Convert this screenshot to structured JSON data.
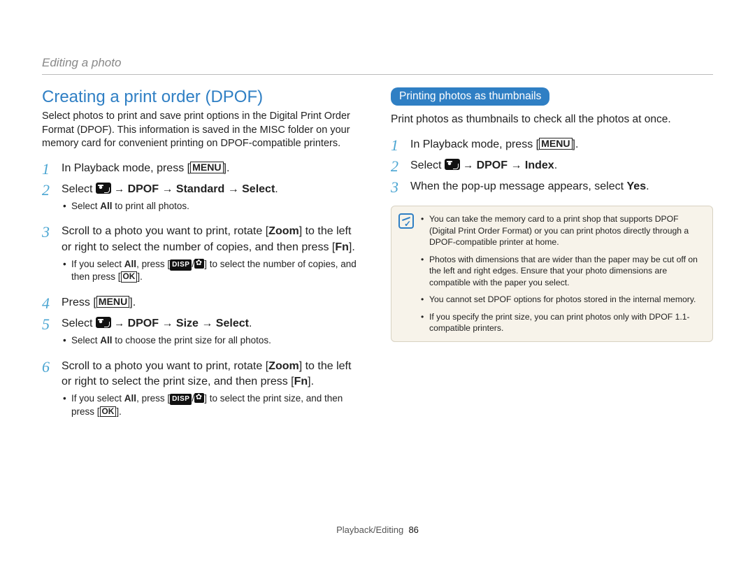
{
  "section_label": "Editing a photo",
  "left": {
    "heading": "Creating a print order (DPOF)",
    "intro": "Select photos to print and save print options in the Digital Print Order Format (DPOF). This information is saved in the MISC folder on your memory card for convenient printing on DPOF-compatible printers.",
    "steps": [
      {
        "num": "1",
        "prefix": "In Playback mode, press [",
        "key": "MENU",
        "suffix": "]."
      },
      {
        "num": "2",
        "select_prefix": "Select ",
        "after_icon": " → ",
        "bold_parts": "DPOF → Standard → Select",
        "tail": ".",
        "sub": [
          {
            "pre": "Select ",
            "bold": "All",
            "post": " to print all photos."
          }
        ]
      },
      {
        "num": "3",
        "text_before_zoom": "Scroll to a photo you want to print, rotate [",
        "zoom": "Zoom",
        "text_mid": "] to the left or right to select the number of copies, and then press [",
        "fn": "Fn",
        "text_after": "].",
        "sub": [
          {
            "pre": "If you select ",
            "bold": "All",
            "mid1": ", press [",
            "disp": "DISP",
            "slash": "/",
            "mid2": "] to select the number of copies, and then press [",
            "ok": "OK",
            "post": "]."
          }
        ]
      },
      {
        "num": "4",
        "prefix": "Press [",
        "key": "MENU",
        "suffix": "]."
      },
      {
        "num": "5",
        "select_prefix": "Select ",
        "after_icon": " → ",
        "bold_parts": "DPOF → Size → Select",
        "tail": ".",
        "sub": [
          {
            "pre": "Select ",
            "bold": "All",
            "post": " to choose the print size for all photos."
          }
        ]
      },
      {
        "num": "6",
        "text_before_zoom": "Scroll to a photo you want to print, rotate [",
        "zoom": "Zoom",
        "text_mid": "] to the left or right to select the print size, and then press [",
        "fn": "Fn",
        "text_after": "].",
        "sub": [
          {
            "pre": "If you select ",
            "bold": "All",
            "mid1": ", press [",
            "disp": "DISP",
            "slash": "/",
            "mid2": "] to select the print size, and then press [",
            "ok": "OK",
            "post": "]."
          }
        ]
      }
    ]
  },
  "right": {
    "pill": "Printing photos as thumbnails",
    "intro": "Print photos as thumbnails to check all the photos at once.",
    "steps": [
      {
        "num": "1",
        "prefix": "In Playback mode, press [",
        "key": "MENU",
        "suffix": "]."
      },
      {
        "num": "2",
        "select_prefix": "Select ",
        "after_icon": " → ",
        "bold_parts": "DPOF → Index",
        "tail": "."
      },
      {
        "num": "3",
        "prefix": "When the pop-up message appears, select ",
        "bold": "Yes",
        "suffix": "."
      }
    ],
    "notes": [
      "You can take the memory card to a print shop that supports DPOF (Digital Print Order Format) or you can print photos directly through a DPOF-compatible printer at home.",
      "Photos with dimensions that are wider than the paper may be cut off on the left and right edges. Ensure that your photo dimensions are compatible with the paper you select.",
      "You cannot set DPOF options for photos stored in the internal memory.",
      "If you specify the print size, you can print photos only with DPOF 1.1-compatible printers."
    ]
  },
  "footer": {
    "section": "Playback/Editing",
    "page": "86"
  }
}
